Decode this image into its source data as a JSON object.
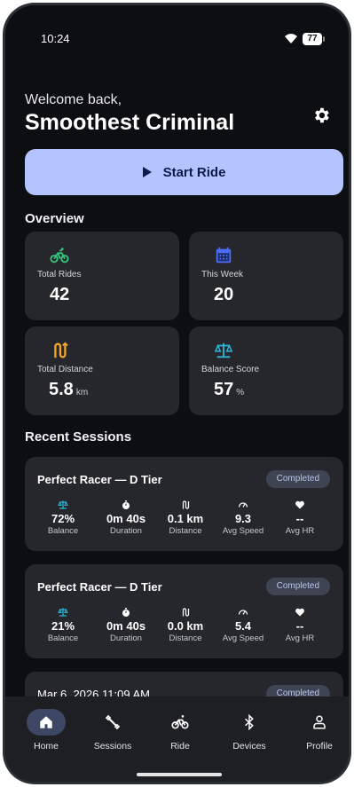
{
  "status_bar": {
    "time": "10:24",
    "battery": "77"
  },
  "header": {
    "welcome": "Welcome back,",
    "user_name": "Smoothest Criminal"
  },
  "start_ride": {
    "label": "Start Ride"
  },
  "overview": {
    "title": "Overview",
    "cards": [
      {
        "icon": "bike-icon",
        "color": "#34c77b",
        "label": "Total Rides",
        "value": "42",
        "unit": ""
      },
      {
        "icon": "calendar-icon",
        "color": "#4a6cf7",
        "label": "This Week",
        "value": "20",
        "unit": ""
      },
      {
        "icon": "route-icon",
        "color": "#f5a623",
        "label": "Total Distance",
        "value": "5.8",
        "unit": "km"
      },
      {
        "icon": "scale-icon",
        "color": "#2ab6d6",
        "label": "Balance Score",
        "value": "57",
        "unit": "%"
      }
    ]
  },
  "recent": {
    "title": "Recent Sessions",
    "sessions": [
      {
        "title": "Perfect Racer — D Tier",
        "badge": "Completed",
        "metrics": [
          {
            "icon": "scale-icon",
            "value": "72%",
            "label": "Balance"
          },
          {
            "icon": "timer-icon",
            "value": "0m 40s",
            "label": "Duration"
          },
          {
            "icon": "route-icon",
            "value": "0.1 km",
            "label": "Distance"
          },
          {
            "icon": "speedometer-icon",
            "value": "9.3",
            "label": "Avg Speed"
          },
          {
            "icon": "heart-icon",
            "value": "--",
            "label": "Avg HR"
          }
        ]
      },
      {
        "title": "Perfect Racer — D Tier",
        "badge": "Completed",
        "metrics": [
          {
            "icon": "scale-icon",
            "value": "21%",
            "label": "Balance"
          },
          {
            "icon": "timer-icon",
            "value": "0m 40s",
            "label": "Duration"
          },
          {
            "icon": "route-icon",
            "value": "0.0 km",
            "label": "Distance"
          },
          {
            "icon": "speedometer-icon",
            "value": "5.4",
            "label": "Avg Speed"
          },
          {
            "icon": "heart-icon",
            "value": "--",
            "label": "Avg HR"
          }
        ]
      },
      {
        "title": "Mar 6, 2026 11:09 AM",
        "badge": "Completed"
      }
    ]
  },
  "nav": {
    "items": [
      {
        "label": "Home",
        "icon": "home-icon",
        "active": true
      },
      {
        "label": "Sessions",
        "icon": "dumbbell-icon",
        "active": false
      },
      {
        "label": "Ride",
        "icon": "bike-icon",
        "active": false
      },
      {
        "label": "Devices",
        "icon": "bluetooth-icon",
        "active": false
      },
      {
        "label": "Profile",
        "icon": "person-icon",
        "active": false
      }
    ]
  },
  "colors": {
    "accent": "#b3c4ff",
    "background": "#0d0e11",
    "card": "#26272d",
    "balance": "#2ab6d6"
  }
}
